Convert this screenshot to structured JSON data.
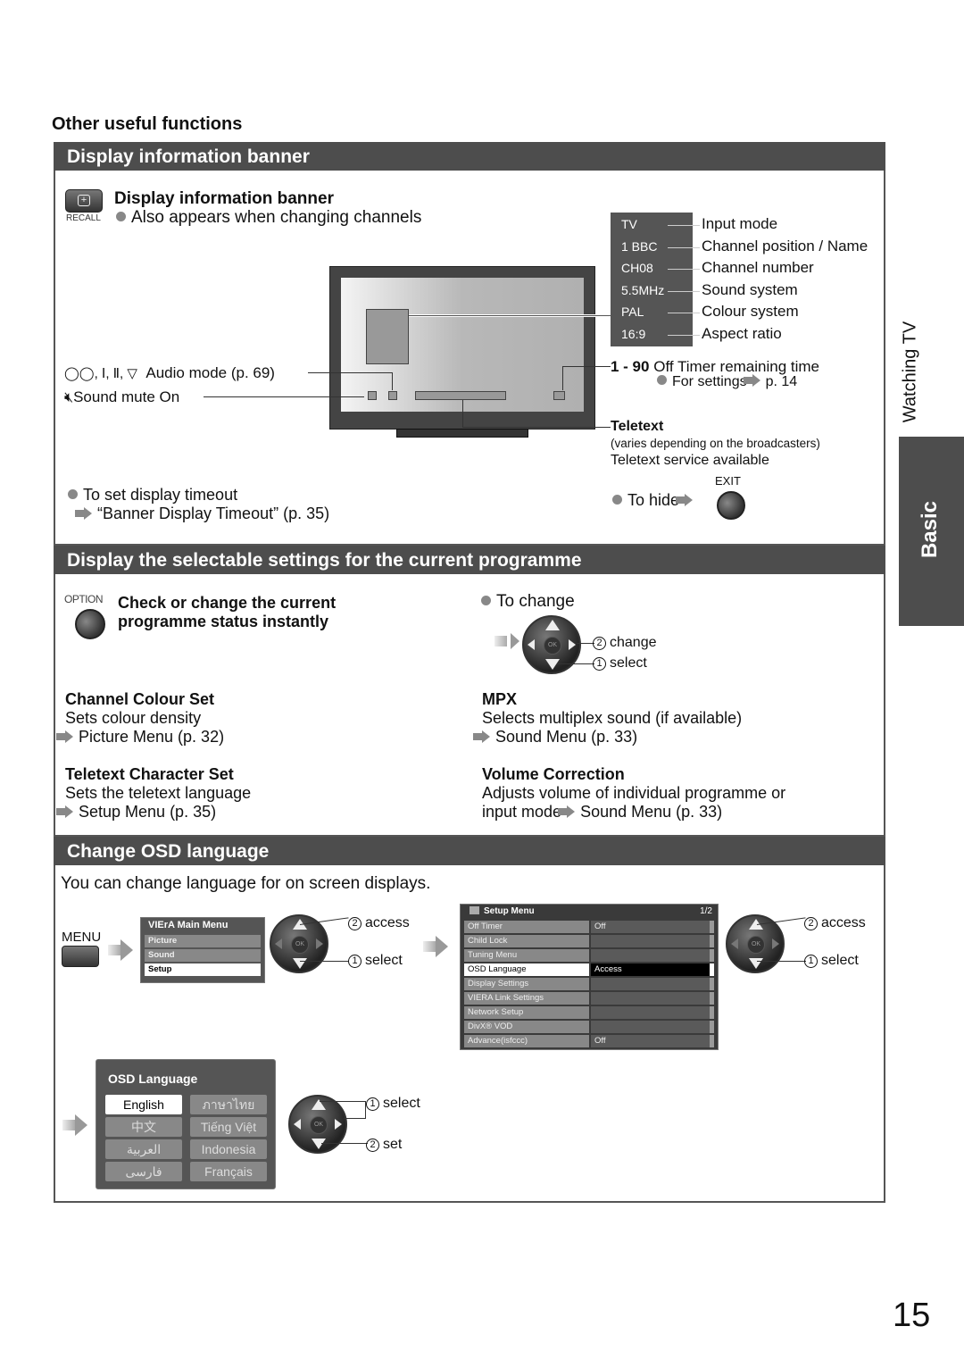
{
  "page": {
    "subheading": "Other useful functions",
    "page_number": "15",
    "side_tab": {
      "section": "Watching TV",
      "chapter": "Basic"
    }
  },
  "banner_section": {
    "title": "Display information banner",
    "button_label": "RECALL",
    "heading": "Display information banner",
    "note": "Also appears when changing channels",
    "banner_items": [
      {
        "value": "TV",
        "label": "Input mode"
      },
      {
        "value": "1 BBC",
        "label": "Channel position / Name"
      },
      {
        "value": "CH08",
        "label": "Channel number"
      },
      {
        "value": "5.5MHz",
        "label": "Sound system"
      },
      {
        "value": "PAL",
        "label": "Colour system"
      },
      {
        "value": "16:9",
        "label": "Aspect ratio"
      }
    ],
    "audio_mode_symbols": "◯◯, Ⅰ, Ⅱ, ▽",
    "audio_mode_label": "Audio mode (p. 69)",
    "mute_label": "Sound mute On",
    "off_timer_range": "1 - 90",
    "off_timer_label": "Off Timer remaining time",
    "off_timer_settings": "For settings",
    "off_timer_page": "p. 14",
    "teletext_heading": "Teletext",
    "teletext_note": "(varies depending on the broadcasters)",
    "teletext_desc": "Teletext service available",
    "timeout_label": "To set display timeout",
    "timeout_ref": "“Banner Display Timeout” (p. 35)",
    "hide_label": "To hide",
    "exit_label": "EXIT"
  },
  "option_section": {
    "title": "Display the selectable settings for the current programme",
    "button_label": "OPTION",
    "heading_line1": "Check or change the current",
    "heading_line2": "programme status instantly",
    "to_change": "To change",
    "step_change": "change",
    "step_select": "select",
    "ok_label": "OK",
    "items": [
      {
        "title": "Channel Colour Set",
        "desc": "Sets colour density",
        "ref": "Picture Menu (p. 32)"
      },
      {
        "title": "MPX",
        "desc": "Selects multiplex sound (if available)",
        "ref": "Sound Menu (p. 33)"
      },
      {
        "title": "Teletext Character Set",
        "desc": "Sets the teletext language",
        "ref": "Setup Menu (p. 35)"
      },
      {
        "title": "Volume Correction",
        "desc": "Adjusts volume of individual programme or",
        "desc2": "input mode",
        "ref": "Sound Menu (p. 33)"
      }
    ]
  },
  "osd_section": {
    "title": "Change OSD language",
    "intro": "You can change language for on screen displays.",
    "menu_button": "MENU",
    "main_menu": {
      "title": "VIErA Main Menu",
      "items": [
        {
          "label": "Picture",
          "selected": false
        },
        {
          "label": "Sound",
          "selected": false
        },
        {
          "label": "Setup",
          "selected": true
        }
      ]
    },
    "step_access": "access",
    "step_select": "select",
    "step_set": "set",
    "num1": "1",
    "num2": "2",
    "ok_label": "OK",
    "setup_menu": {
      "title": "Setup Menu",
      "page": "1/2",
      "rows": [
        {
          "label": "Off Timer",
          "value": "Off",
          "selected": false
        },
        {
          "label": "Child Lock",
          "value": "",
          "selected": false
        },
        {
          "label": "Tuning Menu",
          "value": "",
          "selected": false
        },
        {
          "label": "OSD Language",
          "value": "Access",
          "selected": true
        },
        {
          "label": "Display Settings",
          "value": "",
          "selected": false
        },
        {
          "label": "VIERA Link Settings",
          "value": "",
          "selected": false
        },
        {
          "label": "Network Setup",
          "value": "",
          "selected": false
        },
        {
          "label": "DivX® VOD",
          "value": "",
          "selected": false
        },
        {
          "label": "Advance(isfccc)",
          "value": "Off",
          "selected": false
        }
      ]
    },
    "language_menu": {
      "title": "OSD Language",
      "options": [
        {
          "label": "English",
          "selected": true
        },
        {
          "label": "ภาษาไทย",
          "selected": false
        },
        {
          "label": "中文",
          "selected": false
        },
        {
          "label": "Tiếng Việt",
          "selected": false
        },
        {
          "label": "العربية",
          "selected": false
        },
        {
          "label": "Indonesia",
          "selected": false
        },
        {
          "label": "فارسى",
          "selected": false
        },
        {
          "label": "Français",
          "selected": false
        }
      ]
    }
  }
}
